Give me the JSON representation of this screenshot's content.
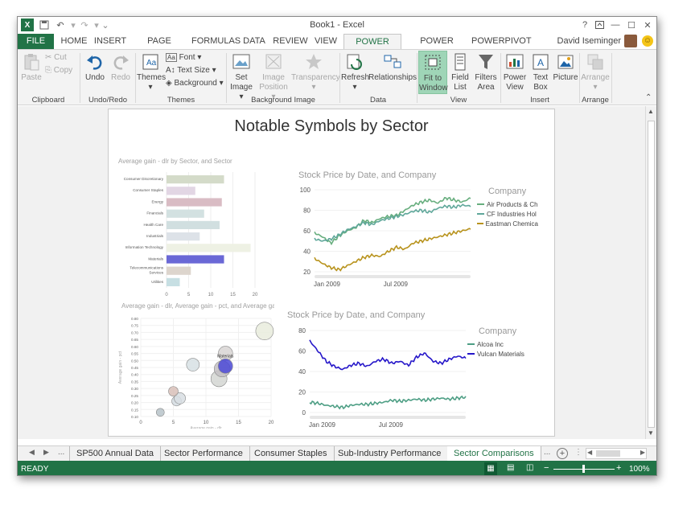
{
  "window": {
    "title": "Book1 - Excel",
    "help": "?",
    "user": "David Iseminger"
  },
  "tabs": [
    {
      "label": "FILE"
    },
    {
      "label": "HOME"
    },
    {
      "label": "INSERT"
    },
    {
      "label": "PAGE LAYOUT"
    },
    {
      "label": "FORMULAS"
    },
    {
      "label": "DATA"
    },
    {
      "label": "REVIEW"
    },
    {
      "label": "VIEW"
    },
    {
      "label": "POWER VIEW"
    },
    {
      "label": "POWER QUERY"
    },
    {
      "label": "POWERPIVOT"
    }
  ],
  "ribbon": {
    "clipboard": {
      "paste": "Paste",
      "cut": "Cut",
      "copy": "Copy",
      "label": "Clipboard"
    },
    "undoredo": {
      "undo": "Undo",
      "redo": "Redo",
      "label": "Undo/Redo"
    },
    "themes": {
      "themes": "Themes",
      "font": "Font",
      "text_size": "Text Size",
      "background": "Background",
      "label": "Themes"
    },
    "bgimage": {
      "set_image": "Set Image",
      "image_position": "Image Position",
      "transparency": "Transparency",
      "label": "Background Image"
    },
    "data": {
      "refresh": "Refresh",
      "relationships": "Relationships",
      "label": "Data"
    },
    "view": {
      "fit": "Fit to Window",
      "field_list": "Field List",
      "filters_area": "Filters Area",
      "label": "View"
    },
    "insert": {
      "power_view": "Power View",
      "text_box": "Text Box",
      "picture": "Picture",
      "label": "Insert"
    },
    "arrange": {
      "arrange": "Arrange",
      "label": "Arrange"
    }
  },
  "report": {
    "title": "Notable Symbols by Sector"
  },
  "chart_data": [
    {
      "type": "bar",
      "orientation": "horizontal",
      "title": "Average gain - dlr by Sector, and Sector",
      "categories": [
        "Consumer Discretionary",
        "Consumer Staples",
        "Energy",
        "Financials",
        "Health Care",
        "Industrials",
        "Information Technology",
        "Materials",
        "Telecommunications Services",
        "Utilities"
      ],
      "values": [
        13,
        6.5,
        12.5,
        8.5,
        12,
        7.5,
        19,
        13,
        5.5,
        3
      ],
      "colors": [
        "#d4dbc9",
        "#e2d6e4",
        "#d9bcc4",
        "#d3e1e1",
        "#d1dfe0",
        "#dde2e8",
        "#eef1e4",
        "#6a68d6",
        "#ddd5cd",
        "#c7dfe3"
      ],
      "xlim": [
        0,
        20
      ],
      "xticks": [
        "0",
        "5",
        "10",
        "15",
        "20"
      ]
    },
    {
      "type": "scatter",
      "title": "Average gain - dlr, Average gain - pct, and Average gain",
      "xlabel": "Average gain - dlr",
      "ylabel": "Average gain - pct",
      "xlim": [
        0,
        20
      ],
      "ylim": [
        0.1,
        0.8
      ],
      "xticks": [
        "0",
        "5",
        "10",
        "15",
        "20"
      ],
      "yticks": [
        "0.10",
        "0.15",
        "0.20",
        "0.25",
        "0.30",
        "0.35",
        "0.40",
        "0.45",
        "0.50",
        "0.55",
        "0.60",
        "0.65",
        "0.70",
        "0.75",
        "0.80"
      ],
      "points": [
        {
          "x": 3,
          "y": 0.13,
          "r": 5,
          "color": "#b7c3c9"
        },
        {
          "x": 5.5,
          "y": 0.21,
          "r": 6,
          "color": "#d4dce2"
        },
        {
          "x": 6,
          "y": 0.23,
          "r": 7,
          "color": "#d8dee3"
        },
        {
          "x": 5,
          "y": 0.28,
          "r": 6,
          "color": "#d8c0b8"
        },
        {
          "x": 8,
          "y": 0.47,
          "r": 8,
          "color": "#d7e1e4"
        },
        {
          "x": 12,
          "y": 0.37,
          "r": 10,
          "color": "#d3d6d2"
        },
        {
          "x": 12.5,
          "y": 0.44,
          "r": 10,
          "color": "#c3c0c3"
        },
        {
          "x": 13,
          "y": 0.55,
          "r": 9,
          "color": "#d8d5d3"
        },
        {
          "x": 13,
          "y": 0.46,
          "r": 9,
          "color": "#4b49d6",
          "label": "Materials"
        },
        {
          "x": 19,
          "y": 0.71,
          "r": 11,
          "color": "#e9ecdd"
        }
      ]
    },
    {
      "type": "line",
      "title": "Stock Price by Date, and Company",
      "legend_title": "Company",
      "xticks": [
        "Jan 2009",
        "Jul 2009"
      ],
      "ylim": [
        20,
        100
      ],
      "yticks": [
        "20",
        "40",
        "60",
        "80",
        "100"
      ],
      "series": [
        {
          "name": "Air Products & Ch",
          "color": "#67ae7e",
          "values": [
            58,
            54,
            48,
            55,
            60,
            63,
            70,
            68,
            72,
            74,
            75,
            80,
            85,
            88,
            90,
            87,
            92,
            90,
            88,
            92
          ]
        },
        {
          "name": "CF Industries Hol",
          "color": "#5fa79a",
          "values": [
            52,
            50,
            52,
            56,
            61,
            64,
            68,
            66,
            70,
            72,
            74,
            76,
            79,
            80,
            78,
            82,
            84,
            83,
            85,
            84
          ]
        },
        {
          "name": "Eastman Chemica",
          "color": "#b8931d",
          "values": [
            33,
            28,
            24,
            22,
            26,
            30,
            34,
            36,
            35,
            40,
            44,
            42,
            48,
            50,
            52,
            54,
            56,
            58,
            60,
            62
          ]
        }
      ]
    },
    {
      "type": "line",
      "title": "Stock Price by Date, and Company",
      "legend_title": "Company",
      "xticks": [
        "Jan 2009",
        "Jul 2009"
      ],
      "ylim": [
        0,
        80
      ],
      "yticks": [
        "0",
        "20",
        "40",
        "60",
        "80"
      ],
      "series": [
        {
          "name": "Alcoa Inc",
          "color": "#4d9e84",
          "values": [
            10,
            9,
            7,
            6,
            5,
            7,
            8,
            8,
            9,
            10,
            12,
            11,
            12,
            13,
            12,
            13,
            14,
            13,
            14,
            15
          ]
        },
        {
          "name": "Vulcan Materials",
          "color": "#2516c9",
          "values": [
            70,
            60,
            50,
            45,
            42,
            46,
            48,
            45,
            50,
            52,
            48,
            50,
            46,
            54,
            58,
            50,
            48,
            52,
            55,
            53
          ]
        }
      ]
    }
  ],
  "sheets": [
    "SP500 Annual Data",
    "Sector Performance",
    "Consumer Staples",
    "Sub-Industry Performance",
    "Sector Comparisons"
  ],
  "sheets_more": "...",
  "status": {
    "ready": "READY",
    "zoom": "100%"
  }
}
